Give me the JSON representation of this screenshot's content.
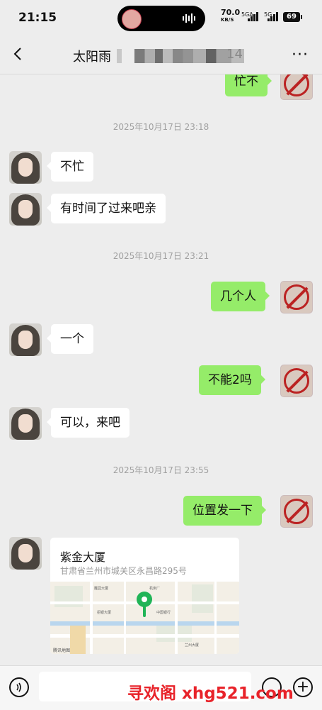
{
  "status_bar": {
    "time": "21:15",
    "net_speed": "70.0",
    "net_unit": "KB/S",
    "sig1": "5GA",
    "sig2": "5G",
    "battery": "69"
  },
  "header": {
    "title": "太阳雨",
    "title_tail": "14"
  },
  "messages": [
    {
      "type": "out",
      "text": "忙不"
    },
    {
      "type": "time",
      "text": "2025年10月17日 23:18"
    },
    {
      "type": "in",
      "text": "不忙"
    },
    {
      "type": "in",
      "text": "有时间了过来吧亲"
    },
    {
      "type": "time",
      "text": "2025年10月17日 23:21"
    },
    {
      "type": "out",
      "text": "几个人"
    },
    {
      "type": "in",
      "text": "一个"
    },
    {
      "type": "out",
      "text": "不能2吗"
    },
    {
      "type": "in",
      "text": "可以，来吧"
    },
    {
      "type": "time",
      "text": "2025年10月17日 23:55"
    },
    {
      "type": "out",
      "text": "位置发一下"
    },
    {
      "type": "location",
      "name": "紫金大厦",
      "address": "甘肃省兰州市城关区永昌路295号",
      "map_brand": "腾讯地图"
    }
  ],
  "watermark": "寻欢阁 xhg521.com",
  "colors": {
    "outgoing_bubble": "#95ec69",
    "incoming_bubble": "#ffffff",
    "background": "#ededed",
    "pin": "#20b457",
    "watermark": "#e8232a"
  }
}
